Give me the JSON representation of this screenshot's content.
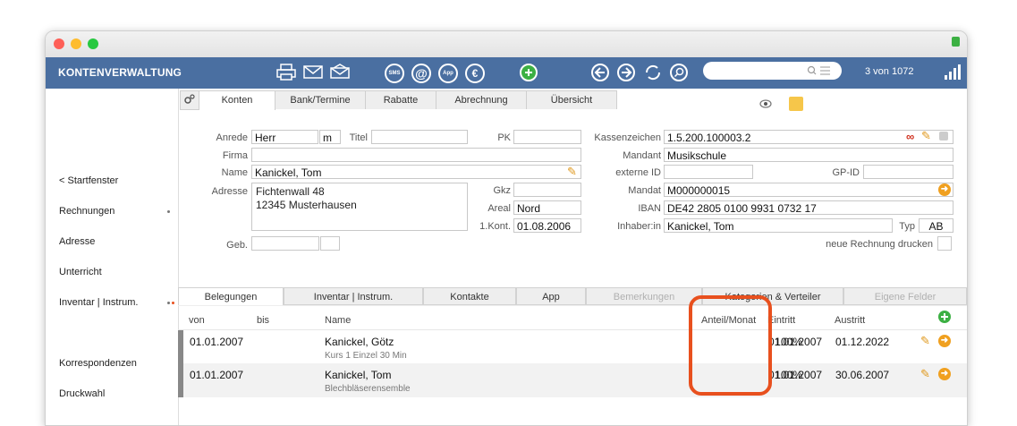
{
  "toolbar": {
    "title": "KONTENVERWALTUNG",
    "record_counter": "3 von 1072",
    "icons": [
      "printer-icon",
      "mail-icon",
      "mail-open-icon",
      "sms-icon",
      "at-icon",
      "app-icon",
      "euro-icon",
      "add-icon",
      "back-icon",
      "forward-icon",
      "refresh-icon",
      "search-icon",
      "signal-icon"
    ],
    "sms_text": "SMS",
    "at_text": "@",
    "app_text": "App",
    "euro_text": "€"
  },
  "sidebar": {
    "items": [
      {
        "label": "< Startfenster"
      },
      {
        "label": "Rechnungen"
      },
      {
        "label": "Adresse"
      },
      {
        "label": "Unterricht"
      },
      {
        "label": "Inventar | Instrum."
      },
      {
        "label": "Korrespondenzen"
      },
      {
        "label": "Druckwahl"
      }
    ]
  },
  "tabs": [
    "Konten",
    "Bank/Termine",
    "Rabatte",
    "Abrechnung",
    "Übersicht"
  ],
  "form": {
    "anrede_label": "Anrede",
    "anrede": "Herr",
    "geschlecht": "m",
    "titel_label": "Titel",
    "titel": "",
    "pk_label": "PK",
    "pk": "",
    "firma_label": "Firma",
    "firma": "",
    "name_label": "Name",
    "name": "Kanickel, Tom",
    "adresse_label": "Adresse",
    "adresse_line1": "Fichtenwall 48",
    "adresse_line2": "12345 Musterhausen",
    "gkz_label": "Gkz",
    "gkz": "",
    "areal_label": "Areal",
    "areal": "Nord",
    "kont_label": "1.Kont.",
    "kont": "01.08.2006",
    "geb_label": "Geb.",
    "geb": "",
    "kassenzeichen_label": "Kassenzeichen",
    "kassenzeichen": "1.5.200.100003.2",
    "infinity": "∞",
    "mandant_label": "Mandant",
    "mandant": "Musikschule",
    "externe_id_label": "externe ID",
    "externe_id": "",
    "gp_id_label": "GP-ID",
    "gp_id": "",
    "mandat_label": "Mandat",
    "mandat": "M000000015",
    "iban_label": "IBAN",
    "iban": "DE42 2805 0100 9931 0732 17",
    "inhaber_label": "Inhaber:in",
    "inhaber": "Kanickel, Tom",
    "typ_label": "Typ",
    "typ": "AB",
    "neue_rechnung_label": "neue Rechnung drucken"
  },
  "bottom_tabs": [
    "Belegungen",
    "Inventar | Instrum.",
    "Kontakte",
    "App",
    "Bemerkungen",
    "Kategorien & Verteiler",
    "Eigene Felder"
  ],
  "table": {
    "headers": {
      "von": "von",
      "bis": "bis",
      "name": "Name",
      "anteil": "Anteil/Monat",
      "eintritt": "Eintritt",
      "austritt": "Austritt"
    },
    "rows": [
      {
        "von": "01.01.2007",
        "bis": "",
        "name": "Kanickel, Götz",
        "detail": "Kurs 1 Einzel 30 Min",
        "anteil": "100%",
        "eintritt": "01.01.2007",
        "austritt": "01.12.2022"
      },
      {
        "von": "01.01.2007",
        "bis": "",
        "name": "Kanickel, Tom",
        "detail": "Blechbläserensemble",
        "anteil": "100%",
        "eintritt": "01.01.2007",
        "austritt": "30.06.2007"
      }
    ]
  },
  "colors": {
    "toolbar": "#4a6fa1",
    "highlight": "#e8501e",
    "accent": "#f0a020",
    "add_green": "#3cb043"
  }
}
